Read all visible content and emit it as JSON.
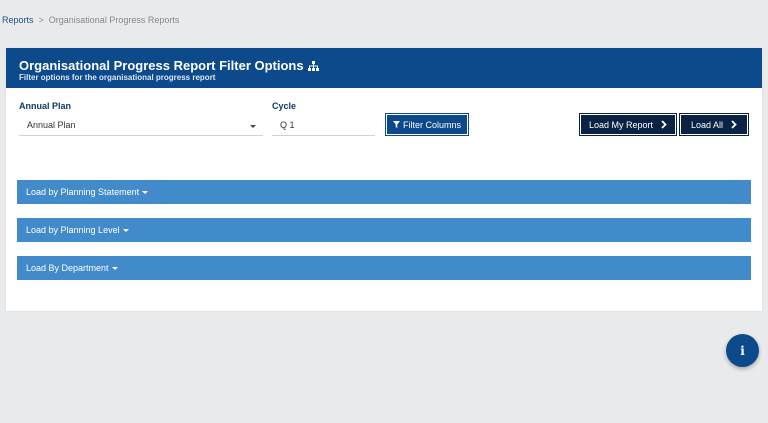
{
  "breadcrumb": {
    "root": "Reports",
    "separator": ">",
    "current": "Organisational Progress Reports"
  },
  "panel": {
    "title": "Organisational Progress Report Filter Options",
    "title_icon": "sitemap-icon",
    "subtitle": "Filter options for the organisational progress report"
  },
  "filters": {
    "annual_plan_label": "Annual Plan",
    "annual_plan_value": "Annual Plan",
    "cycle_label": "Cycle",
    "cycle_value": "Q 1"
  },
  "buttons": {
    "filter_columns": "Filter Columns",
    "load_my_report": "Load My Report",
    "load_all": "Load All"
  },
  "accordions": [
    {
      "label": "Load by Planning Statement"
    },
    {
      "label": "Load by Planning Level"
    },
    {
      "label": "Load By Department"
    }
  ],
  "colors": {
    "header": "#0d4a8c",
    "accordion": "#428bca",
    "dark_button": "#0a2344"
  },
  "info_button": {
    "icon": "info-icon"
  }
}
